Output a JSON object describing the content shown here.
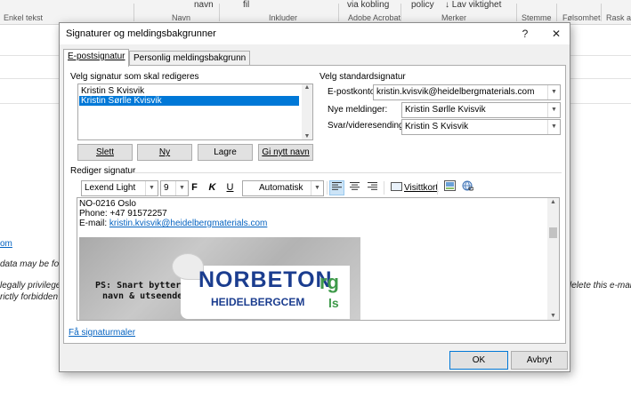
{
  "ribbon": {
    "enkel_tekst": "Enkel tekst",
    "navn_top": "navn",
    "navn_group": "Navn",
    "fil_top": "fil",
    "inkluder_group": "Inkluder",
    "via_kobling": "via kobling",
    "adobe_group": "Adobe Acrobat",
    "policy": "policy",
    "lav_viktighet": "Lav viktighet",
    "merker_group": "Merker",
    "stemme_group": "Stemme",
    "folsomhet_group": "Følsomhet",
    "rask_group": "Rask av"
  },
  "background": {
    "om": "om",
    "line1": "data may be fo",
    "line2": "legally privilege",
    "line3": "rictly forbidden",
    "right_text": "lelete this e-mail"
  },
  "dialog": {
    "title": "Signaturer og meldingsbakgrunner",
    "help": "?",
    "close": "✕",
    "tabs": [
      "E-postsignatur",
      "Personlig meldingsbakgrunn"
    ],
    "choose_label": "Velg signatur som skal redigeres",
    "signatures": [
      "Kristin S Kvisvik",
      "Kristin Sørlle Kvisvik"
    ],
    "buttons": {
      "delete": "Slett",
      "new": "Ny",
      "save": "Lagre",
      "rename": "Gi nytt navn"
    },
    "default": {
      "heading": "Velg standardsignatur",
      "account_label": "E-postkonto:",
      "account_value": "kristin.kvisvik@heidelbergmaterials.com",
      "new_label": "Nye meldinger:",
      "new_value": "Kristin Sørlle Kvisvik",
      "reply_label": "Svar/videresendinger:",
      "reply_value": "Kristin S Kvisvik"
    },
    "edit_label": "Rediger signatur",
    "toolbar": {
      "font": "Lexend Light",
      "size": "9",
      "bold": "F",
      "italic": "K",
      "underline": "U",
      "color": "Automatisk",
      "business_card": "Visittkort"
    },
    "editor": {
      "line1": "NO-0216 Oslo",
      "line2": "Phone: +47 91572257",
      "email_prefix": "E-mail: ",
      "email": "kristin.kvisvik@heidelbergmaterials.com",
      "banner_ps_line1": "PS: Snart bytter vi",
      "banner_ps_line2": "navn & utseende",
      "banner_brand": "NORBETON",
      "banner_sub": "HEIDELBERGCEM",
      "banner_green1": "rg",
      "banner_green2": "ls"
    },
    "templates_link": "Få signaturmaler",
    "ok": "OK",
    "cancel": "Avbryt"
  },
  "colors": {
    "selection": "#0078d7",
    "link": "#0563c1",
    "brand_blue": "#1b3d8f",
    "brand_green": "#3e9a4a"
  }
}
